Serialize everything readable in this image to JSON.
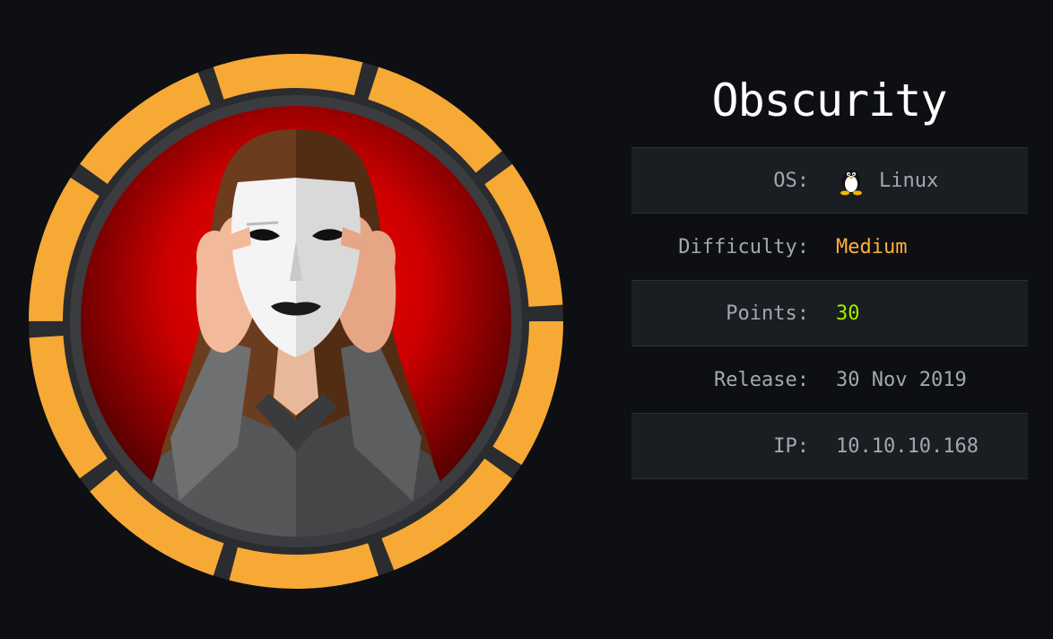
{
  "machine": {
    "name": "Obscurity"
  },
  "info": {
    "os_label": "OS:",
    "os_value": "Linux",
    "os_icon": "linux-tux-icon",
    "difficulty_label": "Difficulty:",
    "difficulty_value": "Medium",
    "points_label": "Points:",
    "points_value": "30",
    "release_label": "Release:",
    "release_value": "30 Nov 2019",
    "ip_label": "IP:",
    "ip_value": "10.10.10.168"
  },
  "colors": {
    "background": "#0d0f12",
    "row_shaded": "#1a1d22",
    "label_text": "#a4a8ae",
    "difficulty_medium": "#ffaf40",
    "points_green": "#9fef00",
    "badge_ring": "#f7a935",
    "badge_inner": "#d40000"
  }
}
